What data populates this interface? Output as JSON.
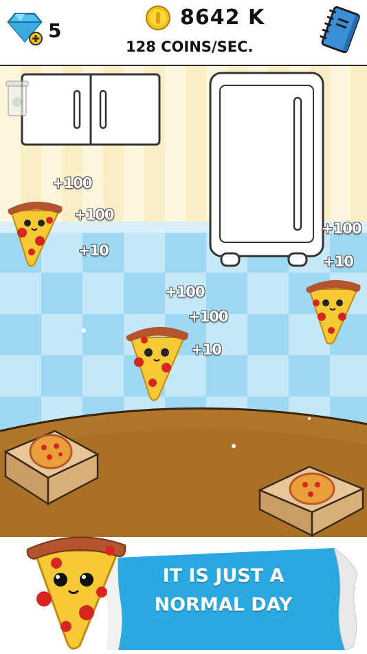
{
  "hud": {
    "gems_count": "5",
    "coins_total": "8642 K",
    "coins_rate": "128 COINS/SEC.",
    "gem_icon": "diamond-plus-icon",
    "coin_icon": "gold-coin-icon",
    "book_icon": "blue-notebook-icon"
  },
  "floating_rewards": [
    "+100",
    "+100",
    "+10",
    "+100",
    "+10",
    "+100",
    "+100",
    "+10"
  ],
  "banner": {
    "line1": "IT IS JUST A",
    "line2": "NORMAL DAY"
  },
  "colors": {
    "wall_cream": "#fdf6dc",
    "tile_blue": "#a7dcf3",
    "table_brown": "#a86b22",
    "banner_blue": "#2aa9e0",
    "pizza_yellow": "#f7c935",
    "pepperoni": "#d7261f",
    "crust": "#b2552e"
  }
}
